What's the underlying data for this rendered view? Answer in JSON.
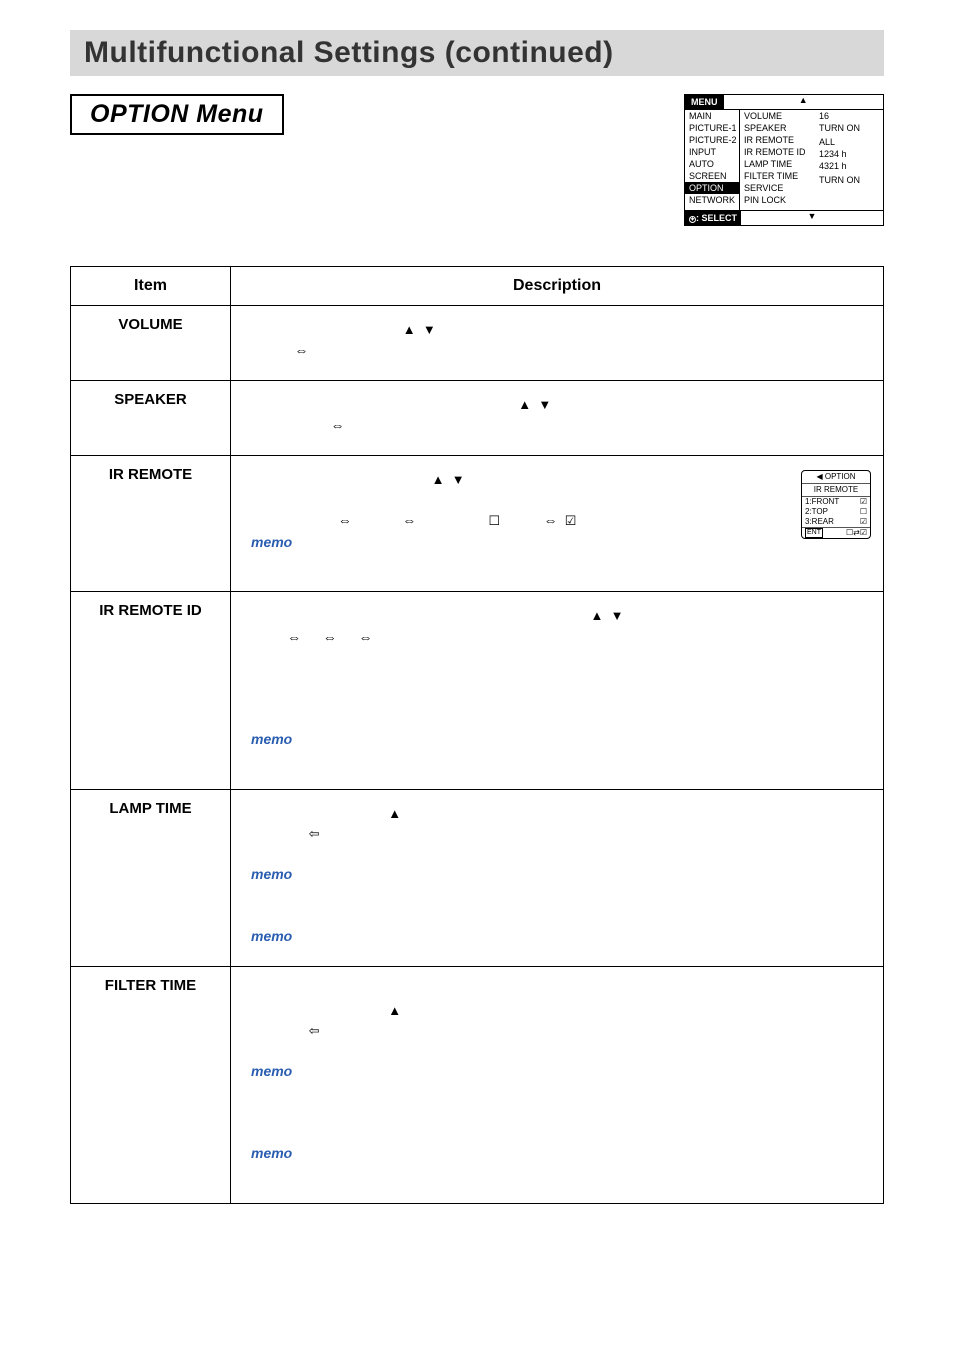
{
  "page": {
    "title": "Multifunctional Settings (continued)",
    "option_title": "OPTION Menu"
  },
  "osd": {
    "menu_label": "MENU",
    "select_label": ": SELECT",
    "col1": [
      "MAIN",
      "PICTURE-1",
      "PICTURE-2",
      "INPUT",
      "AUTO",
      "SCREEN",
      "OPTION",
      "NETWORK"
    ],
    "col2": [
      "VOLUME",
      "SPEAKER",
      "IR REMOTE",
      "IR REMOTE ID",
      "LAMP TIME",
      "FILTER TIME",
      "SERVICE",
      "PIN LOCK"
    ],
    "col3": [
      "16",
      "TURN ON",
      "",
      "ALL",
      "1234 h",
      "4321 h",
      "",
      "TURN ON"
    ],
    "selected": "OPTION"
  },
  "table": {
    "header_item": "Item",
    "header_desc": "Description",
    "rows": [
      {
        "item": "VOLUME",
        "memo_count": 0
      },
      {
        "item": "SPEAKER",
        "memo_count": 0
      },
      {
        "item": "IR REMOTE",
        "memo_count": 1
      },
      {
        "item": "IR REMOTE ID",
        "memo_count": 1
      },
      {
        "item": "LAMP TIME",
        "memo_count": 2
      },
      {
        "item": "FILTER TIME",
        "memo_count": 2
      }
    ],
    "memo_label": "memo"
  },
  "ir_submenu": {
    "back": "◀ OPTION",
    "title": "IR REMOTE",
    "rows": [
      {
        "label": "1:FRONT",
        "checked": true
      },
      {
        "label": "2:TOP",
        "checked": false
      },
      {
        "label": "3:REAR",
        "checked": true
      }
    ],
    "ent": "ENT"
  },
  "glyphs": {
    "tri_up": "▲",
    "tri_down": "▼",
    "lr": "⇔",
    "left": "⇦",
    "box": "☐",
    "box_chk": "☑"
  }
}
